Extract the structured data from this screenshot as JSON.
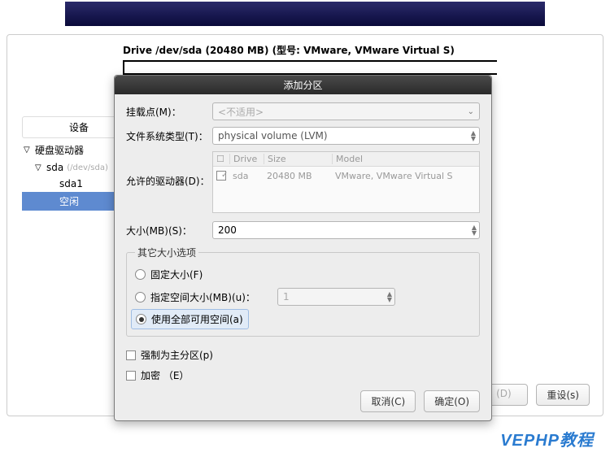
{
  "header": {
    "drive_line": "Drive /dev/sda (20480 MB) (型号: VMware, VMware Virtual S)"
  },
  "columns": {
    "device": "设备"
  },
  "tree": {
    "root": "硬盘驱动器",
    "disk": "sda",
    "disk_path": "(/dev/sda)",
    "part1": "sda1",
    "free": "空闲"
  },
  "bottom": {
    "d_btn": "(D)",
    "reset_btn": "重设(s)"
  },
  "dialog": {
    "title": "添加分区",
    "mount_label": "挂载点(M)：",
    "mount_value": "<不适用>",
    "fstype_label": "文件系统类型(T)：",
    "fstype_value": "physical volume (LVM)",
    "allowable_label": "允许的驱动器(D)：",
    "drive_table": {
      "h_drive": "Drive",
      "h_size": "Size",
      "h_model": "Model",
      "r_drive": "sda",
      "r_size": "20480 MB",
      "r_model": "VMware, VMware Virtual S"
    },
    "size_label": "大小(MB)(S)：",
    "size_value": "200",
    "size_opts_legend": "其它大小选项",
    "opt_fixed": "固定大小(F)",
    "opt_upto": "指定空间大小(MB)(u)：",
    "opt_upto_value": "1",
    "opt_fill": "使用全部可用空间(a)",
    "chk_primary": "强制为主分区(p)",
    "chk_encrypt": "加密 （E）",
    "cancel": "取消(C)",
    "ok": "确定(O)"
  },
  "watermark": "VEPHP教程"
}
